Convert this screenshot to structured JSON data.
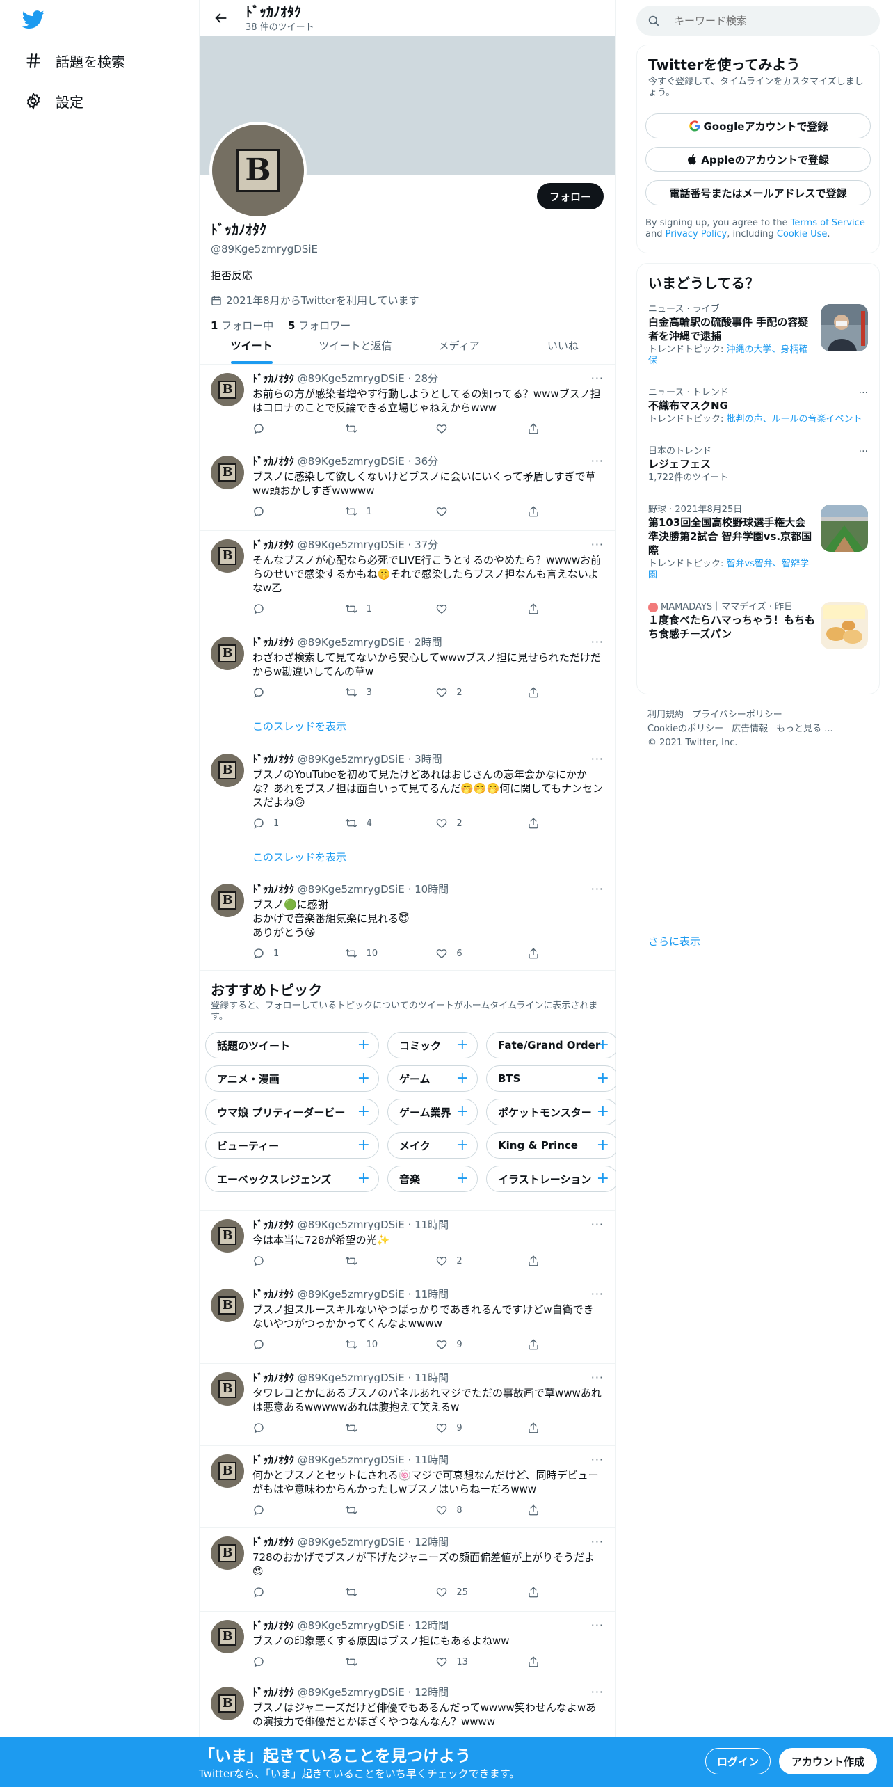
{
  "nav": {
    "explore": "話題を検索",
    "settings": "設定"
  },
  "header": {
    "name": "ﾄﾞｯｶﾉｵﾀｸ",
    "tweet_count": "38 件のツイート"
  },
  "profile": {
    "avatar_letter": "B",
    "follow_label": "フォロー",
    "name": "ﾄﾞｯｶﾉｵﾀｸ",
    "handle": "@89Kge5zmrygDSiE",
    "bio": "拒否反応",
    "joined": "2021年8月からTwitterを利用しています",
    "following_count": "1",
    "following_label": "フォロー中",
    "followers_count": "5",
    "followers_label": "フォロワー"
  },
  "tabs": [
    "ツイート",
    "ツイートと返信",
    "メディア",
    "いいね"
  ],
  "tweets": [
    {
      "name": "ﾄﾞｯｶﾉｵﾀｸ",
      "meta": "@89Kge5zmrygDSiE · 28分",
      "text": "お前らの方が感染者増やす行動しようとしてるの知ってる？wwwブスノ担はコロナのことで反論できる立場じゃねえからwww",
      "reply": "",
      "retweet": "",
      "like": ""
    },
    {
      "name": "ﾄﾞｯｶﾉｵﾀｸ",
      "meta": "@89Kge5zmrygDSiE · 36分",
      "text": "ブスノに感染して欲しくないけどブスノに会いにいくって矛盾しすぎで草ww頭おかしすぎwwwww",
      "reply": "",
      "retweet": "1",
      "like": ""
    },
    {
      "name": "ﾄﾞｯｶﾉｵﾀｸ",
      "meta": "@89Kge5zmrygDSiE · 37分",
      "text": "そんなブスノが心配なら必死でLIVE行こうとするのやめたら？wwwwお前らのせいで感染するかもね🤫それで感染したらブスノ担なんも言えないよなw乙",
      "reply": "",
      "retweet": "1",
      "like": ""
    },
    {
      "name": "ﾄﾞｯｶﾉｵﾀｸ",
      "meta": "@89Kge5zmrygDSiE · 2時間",
      "text": "わざわざ検索して見てないから安心してwwwブスノ担に見せられただけだからw勘違いしてんの草w",
      "reply": "",
      "retweet": "3",
      "like": "2",
      "thread": "このスレッドを表示"
    },
    {
      "name": "ﾄﾞｯｶﾉｵﾀｸ",
      "meta": "@89Kge5zmrygDSiE · 3時間",
      "text": "ブスノのYouTubeを初めて見たけどあれはおじさんの忘年会かなにかかな？あれをブスノ担は面白いって見てるんだ🤭🤭🤭何に関してもナンセンスだよね🙃",
      "reply": "1",
      "retweet": "4",
      "like": "2",
      "thread": "このスレッドを表示"
    },
    {
      "name": "ﾄﾞｯｶﾉｵﾀｸ",
      "meta": "@89Kge5zmrygDSiE · 10時間",
      "text": "ブスノ🟢に感謝\nおかげで音楽番組気楽に見れる😇\nありがとう😘",
      "reply": "1",
      "retweet": "10",
      "like": "6"
    },
    {
      "name": "ﾄﾞｯｶﾉｵﾀｸ",
      "meta": "@89Kge5zmrygDSiE · 11時間",
      "text": "今は本当に728が希望の光✨",
      "reply": "",
      "retweet": "",
      "like": "2"
    },
    {
      "name": "ﾄﾞｯｶﾉｵﾀｸ",
      "meta": "@89Kge5zmrygDSiE · 11時間",
      "text": "ブスノ担スルースキルないやつばっかりであきれるんですけどw自衛できないやつがつっかかってくんなよwwww",
      "reply": "",
      "retweet": "10",
      "like": "9"
    },
    {
      "name": "ﾄﾞｯｶﾉｵﾀｸ",
      "meta": "@89Kge5zmrygDSiE · 11時間",
      "text": "タワレコとかにあるブスノのパネルあれマジでただの事故画で草wwwあれは悪意あるwwwwwあれは腹抱えて笑えるw",
      "reply": "",
      "retweet": "",
      "like": "9"
    },
    {
      "name": "ﾄﾞｯｶﾉｵﾀｸ",
      "meta": "@89Kge5zmrygDSiE · 11時間",
      "text": "何かとブスノとセットにされる🍥マジで可哀想なんだけど、同時デビューがもはや意味わからんかったしwブスノはいらねーだろwww",
      "reply": "",
      "retweet": "",
      "like": "8"
    },
    {
      "name": "ﾄﾞｯｶﾉｵﾀｸ",
      "meta": "@89Kge5zmrygDSiE · 12時間",
      "text": "728のおかげでブスノが下げたジャニーズの顔面偏差値が上がりそうだよ😍",
      "reply": "",
      "retweet": "",
      "like": "25"
    },
    {
      "name": "ﾄﾞｯｶﾉｵﾀｸ",
      "meta": "@89Kge5zmrygDSiE · 12時間",
      "text": "ブスノの印象悪くする原因はブスノ担にもあるよねww",
      "reply": "",
      "retweet": "",
      "like": "13"
    },
    {
      "name": "ﾄﾞｯｶﾉｵﾀｸ",
      "meta": "@89Kge5zmrygDSiE · 12時間",
      "text": "ブスノはジャニーズだけど俳優でもあるんだってwwww笑わせんなよwあの演技力で俳優だとかほざくやつなんなん？wwww",
      "reply": "",
      "retweet": "",
      "like": ""
    }
  ],
  "topics": {
    "title": "おすすめトピック",
    "desc": "登録すると、フォローしているトピックについてのツイートがホームタイムラインに表示されます。",
    "plus": "+",
    "rows": [
      [
        "話題のツイート",
        "コミック",
        "Fate/Grand Order"
      ],
      [
        "アニメ・漫画",
        "ゲーム",
        "BTS"
      ],
      [
        "ウマ娘 プリティーダービー",
        "ゲーム業界",
        "ポケットモンスター"
      ],
      [
        "ビューティー",
        "メイク",
        "King & Prince"
      ],
      [
        "エーベックスレジェンズ",
        "音楽",
        "イラストレーション"
      ]
    ]
  },
  "search": {
    "placeholder": "キーワード検索"
  },
  "signup": {
    "title": "Twitterを使ってみよう",
    "sub": "今すぐ登録して、タイムラインをカスタマイズしましょう。",
    "google": "Googleアカウントで登録",
    "apple": "Appleのアカウントで登録",
    "phone": "電話番号またはメールアドレスで登録",
    "terms_pre": "By signing up, you agree to the ",
    "terms_tos": "Terms of Service",
    "terms_and": " and ",
    "terms_privacy": "Privacy Policy",
    "terms_incl": ", including ",
    "terms_cookie": "Cookie Use",
    "terms_end": "."
  },
  "trends": {
    "title": "いまどうしてる？",
    "items": [
      {
        "meta": "ニュース · ライブ",
        "title": "白金高輪駅の硫酸事件 手配の容疑者を沖縄で逮捕",
        "sub_pre": "トレンドトピック: ",
        "sub_links": "沖縄の大学、身柄確保"
      },
      {
        "meta": "ニュース · トレンド",
        "title": "不織布マスクNG",
        "sub_pre": "トレンドトピック: ",
        "sub_links": "批判の声、ルールの音楽イベント"
      },
      {
        "meta": "日本のトレンド",
        "title": "レジェフェス",
        "sub_pre": "",
        "sub_links": "1,722件のツイート"
      },
      {
        "meta": "野球 · 2021年8月25日",
        "title": "第103回全国高校野球選手権大会 準決勝第2試合 智弁学園vs.京都国際",
        "sub_pre": "トレンドトピック: ",
        "sub_links": "智弁vs智弁、智辯学園"
      },
      {
        "meta": "MAMADAYS｜ママデイズ · 昨日",
        "title": "１度食べたらハマっちゃう！もちもち食感チーズパン",
        "sub_pre": "",
        "sub_links": ""
      }
    ],
    "show_more": "さらに表示",
    "more_dots": "···"
  },
  "footer": {
    "links": [
      "利用規約",
      "プライバシーポリシー",
      "Cookieのポリシー",
      "広告情報",
      "もっと見る ..."
    ],
    "copyright": "© 2021 Twitter, Inc."
  },
  "bottom": {
    "title": "「いま」起きていることを見つけよう",
    "sub": "Twitterなら、「いま」起きていることをいち早くチェックできます。",
    "login": "ログイン",
    "signup": "アカウント作成"
  },
  "colors": {
    "accent": "#1d9bf0",
    "banner": "#cfd9de",
    "bottom_bar": "#1d9bf0"
  }
}
